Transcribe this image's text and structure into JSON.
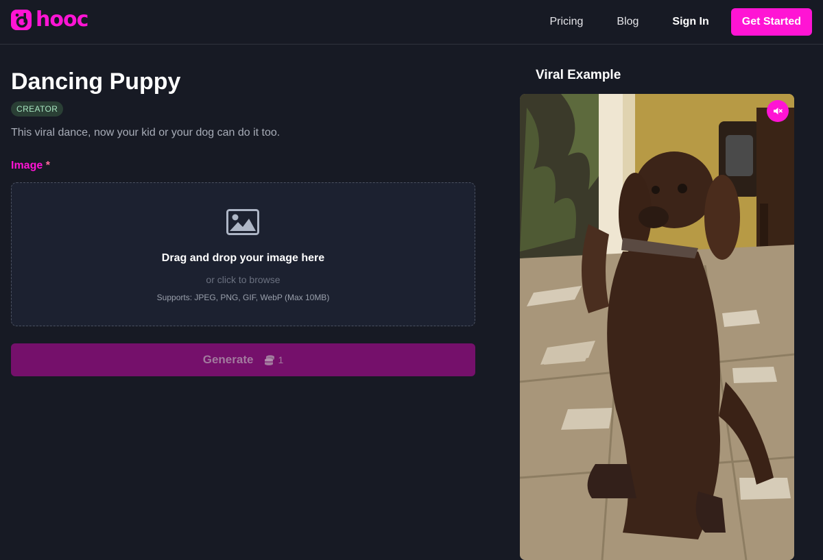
{
  "brand": {
    "name": "hooc",
    "accent": "#ff14d4"
  },
  "nav": {
    "pricing": "Pricing",
    "blog": "Blog",
    "sign_in": "Sign In",
    "get_started": "Get Started"
  },
  "template": {
    "title": "Dancing Puppy",
    "badge": "CREATOR",
    "description": "This viral dance, now your kid or your dog can do it too."
  },
  "form": {
    "image_label": "Image",
    "required_marker": "*",
    "dropzone": {
      "icon": "image-icon",
      "title": "Drag and drop your image here",
      "subtitle": "or click to browse",
      "supports": "Supports: JPEG, PNG, GIF, WebP (Max 10MB)"
    },
    "generate": {
      "label": "Generate",
      "cost_icon": "coins-icon",
      "cost": "1"
    }
  },
  "example": {
    "title": "Viral Example",
    "mute_icon": "speaker-muted-icon"
  }
}
